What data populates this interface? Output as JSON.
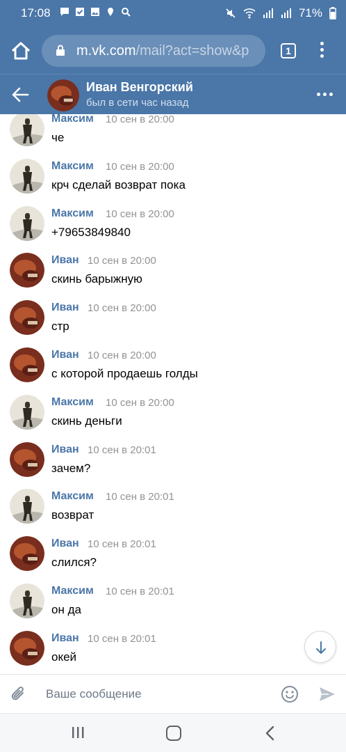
{
  "status_bar": {
    "time": "17:08",
    "battery": "71%"
  },
  "browser": {
    "url_host": "m.vk.com",
    "url_path": "/mail?act=show&p",
    "tab_count": "1"
  },
  "chat_header": {
    "name": "Иван Венгорский",
    "status": "был в сети час назад"
  },
  "messages": [
    {
      "author": "Максим",
      "time": "10 сен в 20:00",
      "text": "че",
      "sender": "maxim"
    },
    {
      "author": "Максим",
      "time": "10 сен в 20:00",
      "text": "крч сделай возврат пока",
      "sender": "maxim"
    },
    {
      "author": "Максим",
      "time": "10 сен в 20:00",
      "text": "+79653849840",
      "sender": "maxim"
    },
    {
      "author": "Иван",
      "time": "10 сен в 20:00",
      "text": "скинь барыжную",
      "sender": "ivan"
    },
    {
      "author": "Иван",
      "time": "10 сен в 20:00",
      "text": "стр",
      "sender": "ivan"
    },
    {
      "author": "Иван",
      "time": "10 сен в 20:00",
      "text": "с которой продаешь голды",
      "sender": "ivan"
    },
    {
      "author": "Максим",
      "time": "10 сен в 20:00",
      "text": "скинь деньги",
      "sender": "maxim"
    },
    {
      "author": "Иван",
      "time": "10 сен в 20:01",
      "text": "зачем?",
      "sender": "ivan"
    },
    {
      "author": "Максим",
      "time": "10 сен в 20:01",
      "text": "возврат",
      "sender": "maxim"
    },
    {
      "author": "Иван",
      "time": "10 сен в 20:01",
      "text": "слился?",
      "sender": "ivan"
    },
    {
      "author": "Максим",
      "time": "10 сен в 20:01",
      "text": "он да",
      "sender": "maxim"
    },
    {
      "author": "Иван",
      "time": "10 сен в 20:01",
      "text": "окей",
      "sender": "ivan"
    }
  ],
  "composer": {
    "placeholder": "Ваше сообщение"
  },
  "colors": {
    "vk_blue": "#4a76a8",
    "author_link": "#4a76a8",
    "meta_gray": "#939393"
  },
  "icons": {
    "status": [
      "messages-icon",
      "checkbox-icon",
      "gallery-icon",
      "location-icon",
      "search-icon",
      "mute-icon",
      "wifi-icon",
      "signal-icon",
      "battery-icon"
    ],
    "browser": [
      "home-icon",
      "lock-icon",
      "tab-switcher-icon",
      "more-vertical-icon"
    ],
    "header": [
      "back-arrow-icon",
      "more-horizontal-icon"
    ],
    "composer": [
      "paperclip-icon",
      "emoji-icon",
      "send-icon"
    ],
    "nav": [
      "recent-apps-icon",
      "home-nav-icon",
      "back-nav-icon"
    ]
  }
}
